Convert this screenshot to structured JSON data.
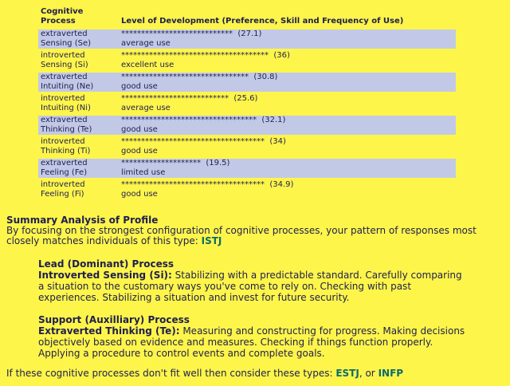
{
  "table": {
    "col1_header_line1": "Cognitive",
    "col1_header_line2": "Process",
    "col2_header": "Level of Development (Preference, Skill and Frequency of Use)",
    "rows": [
      {
        "line1": "extraverted",
        "line2": "Sensing (Se)",
        "stars": "****************************",
        "score": "(27.1)",
        "use": "average use"
      },
      {
        "line1": "introverted",
        "line2": "Sensing (Si)",
        "stars": "*************************************",
        "score": "(36)",
        "use": "excellent use"
      },
      {
        "line1": "extraverted",
        "line2": "Intuiting (Ne)",
        "stars": "********************************",
        "score": "(30.8)",
        "use": "good use"
      },
      {
        "line1": "introverted",
        "line2": "Intuiting (Ni)",
        "stars": "***************************",
        "score": "(25.6)",
        "use": "average use"
      },
      {
        "line1": "extraverted",
        "line2": "Thinking (Te)",
        "stars": "**********************************",
        "score": "(32.1)",
        "use": "good use"
      },
      {
        "line1": "introverted",
        "line2": "Thinking (Ti)",
        "stars": "************************************",
        "score": "(34)",
        "use": "good use"
      },
      {
        "line1": "extraverted",
        "line2": "Feeling (Fe)",
        "stars": "********************",
        "score": "(19.5)",
        "use": "limited use"
      },
      {
        "line1": "introverted",
        "line2": "Feeling (Fi)",
        "stars": "************************************",
        "score": "(34.9)",
        "use": "good use"
      }
    ]
  },
  "summary": {
    "heading": "Summary Analysis of Profile",
    "text": "By focusing on the strongest configuration of cognitive processes, your pattern of responses most closely matches individuals of this type:",
    "type": "ISTJ"
  },
  "lead": {
    "heading": "Lead (Dominant) Process",
    "process": "Introverted Sensing (Si):",
    "text": "Stabilizing with a predictable standard. Carefully comparing a situation to the customary ways you've come to rely on. Checking with past experiences. Stabilizing a situation and invest for future security."
  },
  "support": {
    "heading": "Support (Auxilliary) Process",
    "process": "Extraverted Thinking (Te):",
    "text": "Measuring and constructing for progress. Making decisions objectively based on evidence and measures. Checking if things function properly. Applying a procedure to control events and complete goals."
  },
  "footer": {
    "text": "If these cognitive processes don't fit well then consider these types:",
    "type1": "ESTJ",
    "sep": ", or",
    "type2": "INFP"
  }
}
